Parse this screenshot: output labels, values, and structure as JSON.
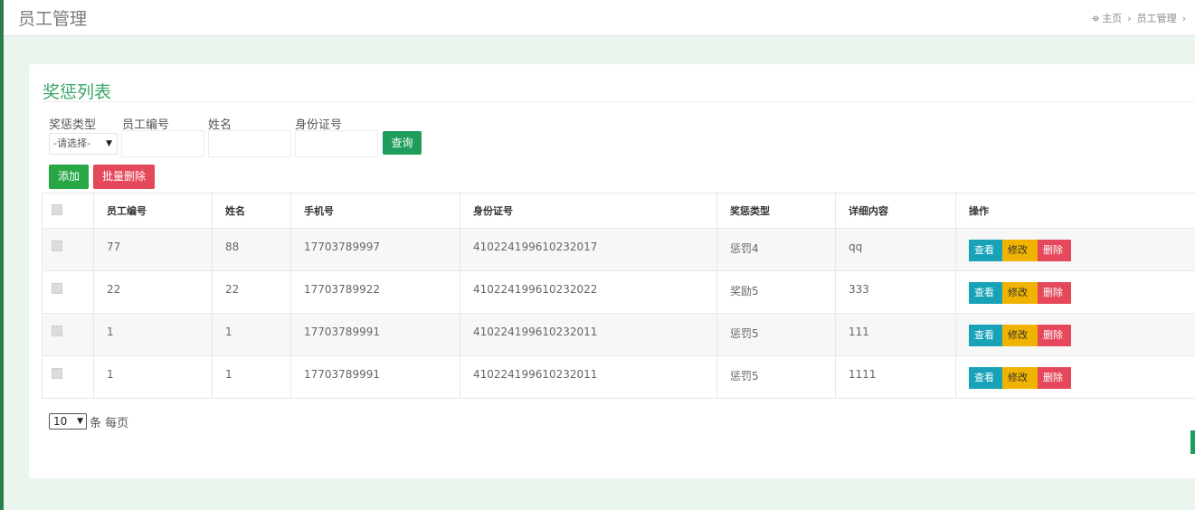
{
  "header": {
    "title": "员工管理",
    "breadcrumb": [
      "主页",
      "员工管理"
    ],
    "breadcrumb_sep": "›",
    "home_icon": "home-icon"
  },
  "panel": {
    "title": "奖惩列表",
    "filters": {
      "type_label": "奖惩类型",
      "type_value": "-请选择-",
      "emp_no_label": "员工编号",
      "name_label": "姓名",
      "id_label": "身份证号",
      "search_label": "查询"
    },
    "actions": {
      "add_label": "添加",
      "batch_delete_label": "批量删除"
    },
    "table": {
      "headers": [
        "员工编号",
        "姓名",
        "手机号",
        "身份证号",
        "奖惩类型",
        "详细内容",
        "操作"
      ],
      "rows": [
        {
          "emp_no": "77",
          "name": "88",
          "phone": "17703789997",
          "id_no": "410224199610232017",
          "type": "惩罚4",
          "detail": "qq"
        },
        {
          "emp_no": "22",
          "name": "22",
          "phone": "17703789922",
          "id_no": "410224199610232022",
          "type": "奖励5",
          "detail": "333"
        },
        {
          "emp_no": "1",
          "name": "1",
          "phone": "17703789991",
          "id_no": "410224199610232011",
          "type": "惩罚5",
          "detail": "111"
        },
        {
          "emp_no": "1",
          "name": "1",
          "phone": "17703789991",
          "id_no": "410224199610232011",
          "type": "惩罚5",
          "detail": "1111"
        }
      ],
      "op_view": "查看",
      "op_edit": "修改",
      "op_delete": "删除"
    },
    "pager": {
      "page_size": "10",
      "suffix": "条 每页"
    }
  },
  "colors": {
    "accent": "#3aa56a",
    "search": "#1e9d5c",
    "add": "#28a745",
    "danger": "#e4485a",
    "info": "#17a2b8",
    "warning": "#f0b400"
  }
}
